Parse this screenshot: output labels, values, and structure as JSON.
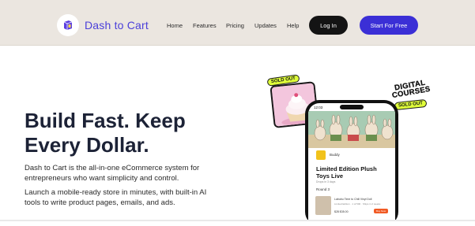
{
  "brand": {
    "name": "Dash to Cart"
  },
  "nav": {
    "items": [
      "Home",
      "Features",
      "Pricing",
      "Updates",
      "Help"
    ]
  },
  "header_buttons": {
    "login": "Log In",
    "start": "Start For Free"
  },
  "hero": {
    "title_line1": "Build Fast. Keep",
    "title_line2": "Every Dollar.",
    "desc1_line1": "Dash to Cart is the all-in-one eCommerce system for",
    "desc1_line2": "entrepreneurs who want simplicity and control.",
    "desc2_line1": "Launch a mobile-ready store in minutes, with built-in AI",
    "desc2_line2": "tools to write product pages, emails, and ads."
  },
  "stickers": {
    "sold_out_card": "SOLD OUT",
    "digital_line1": "DIGITAL",
    "digital_line2": "COURSES",
    "sold_out_phone": "SOLD OUT"
  },
  "phone": {
    "time": "12:03",
    "shop_name": "Buddy",
    "title": "Limited Edition Plush Toys Live",
    "subtitle": "Drops in 3 days",
    "label": "Round 3",
    "product_name": "Labubu Time to Chill Vinyl Doll",
    "product_meta": "Limited Edition · 1 of 500 · Ships in 2 weeks",
    "product_price": "$28  $35.00",
    "product_button": "Buy Now"
  },
  "colors": {
    "header_bg": "#ebe6e0",
    "brand": "#4a3fd9",
    "start_button": "#3b2fd6",
    "login_button": "#141414",
    "sticker": "#dfff3a",
    "title": "#1c2236"
  }
}
